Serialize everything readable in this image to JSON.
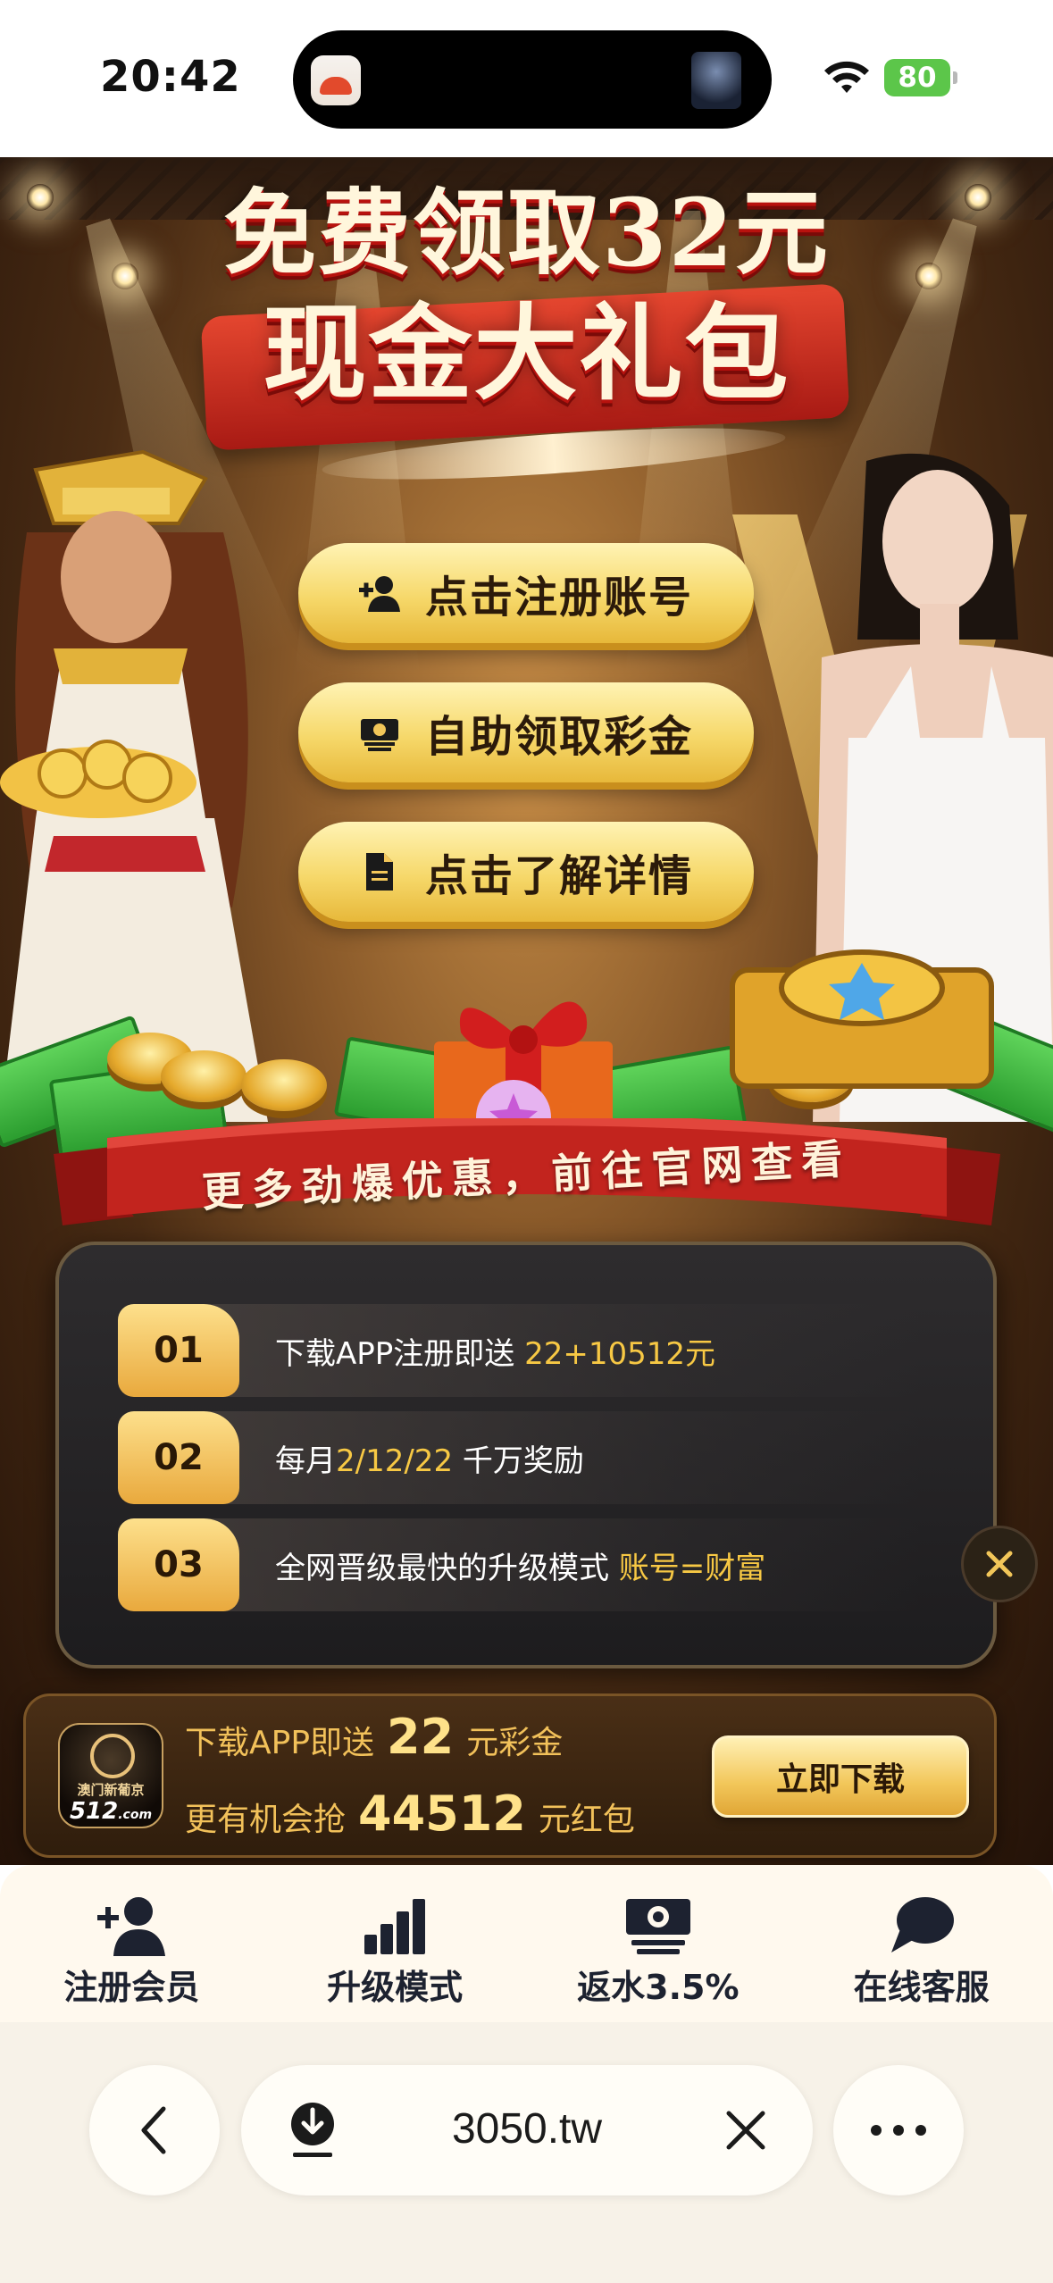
{
  "status_bar": {
    "time": "20:42",
    "battery": "80",
    "icons": [
      "wifi-icon",
      "battery-charging-icon"
    ]
  },
  "hero": {
    "headline_line1": "免费领取32元",
    "headline_line2": "现金大礼包"
  },
  "actions": [
    {
      "label": "点击注册账号",
      "icon": "add-user-icon"
    },
    {
      "label": "自助领取彩金",
      "icon": "cash-icon"
    },
    {
      "label": "点击了解详情",
      "icon": "document-icon"
    }
  ],
  "ribbon_text": "更多劲爆优惠，前往官网查看",
  "promos": [
    {
      "num": "01",
      "text": "下载APP注册即送",
      "highlight": "22+10512元",
      "suffix": ""
    },
    {
      "num": "02",
      "text": "每月",
      "highlight": "2/12/22",
      "suffix": "千万奖励"
    },
    {
      "num": "03",
      "text": "全网晋级最快的升级模式",
      "highlight": "账号=财富",
      "suffix": ""
    }
  ],
  "download_bar": {
    "logo_caption": "澳门新葡京",
    "logo_number": "512",
    "logo_domain": ".com",
    "line1_prefix": "下载APP即送",
    "line1_amount": "22",
    "line1_suffix": "元彩金",
    "line2_prefix": "更有机会抢",
    "line2_amount": "44512",
    "line2_suffix": "元红包",
    "button": "立即下载"
  },
  "tabs": [
    {
      "label": "注册会员",
      "icon": "add-user-icon"
    },
    {
      "label": "升级模式",
      "icon": "bar-chart-icon"
    },
    {
      "label": "返水3.5%",
      "icon": "cash-icon"
    },
    {
      "label": "在线客服",
      "icon": "chat-icon"
    }
  ],
  "browser": {
    "url": "3050.tw"
  },
  "colors": {
    "gold": "#f2c659",
    "highlight": "#f7c844",
    "red": "#b8120e",
    "panel": "#1d1c1e",
    "tab_text": "#1d2230"
  }
}
